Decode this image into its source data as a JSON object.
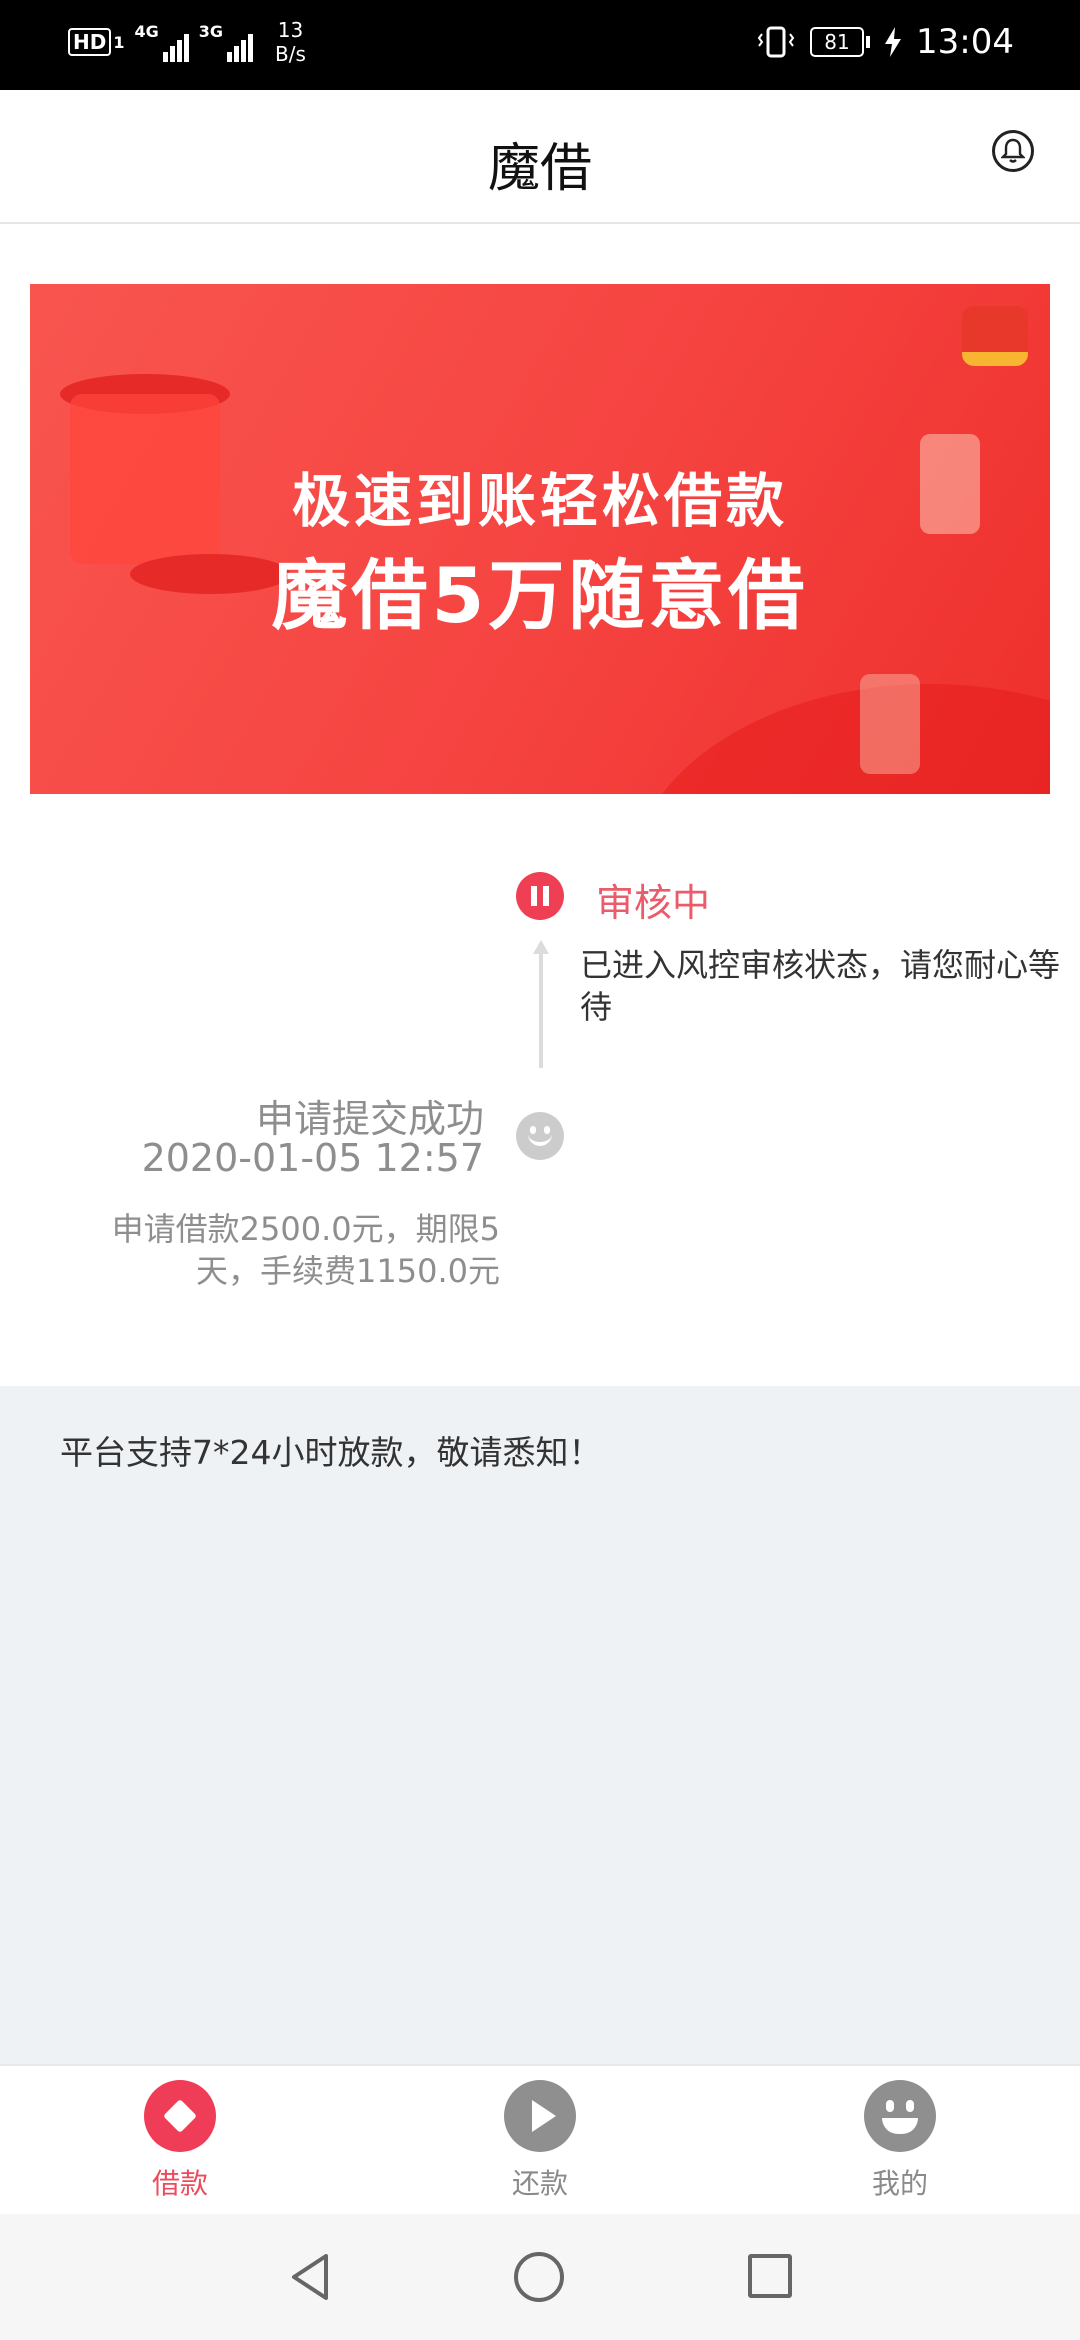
{
  "status_bar": {
    "hd_badge": "HD",
    "sim1_badge": "1",
    "network1": "4G",
    "network2": "3G",
    "speed_value": "13",
    "speed_unit": "B/s",
    "battery": "81",
    "time": "13:04"
  },
  "header": {
    "title": "魔借",
    "icon": "bell-icon"
  },
  "banner": {
    "line1": "极速到账轻松借款",
    "line2": "魔借5万随意借"
  },
  "timeline": {
    "current": {
      "title": "审核中",
      "description": "已进入风控审核状态，请您耐心等待",
      "icon": "pause-icon",
      "color": "#ef3f55"
    },
    "submitted": {
      "title": "申请提交成功",
      "time": "2020-01-05 12:57",
      "description": "申请借款2500.0元，期限5天，手续费1150.0元",
      "icon": "smile-icon"
    }
  },
  "notice": {
    "text": "平台支持7*24小时放款，敬请悉知！"
  },
  "tabbar": {
    "items": [
      {
        "label": "借款",
        "icon": "borrow-icon",
        "active": true
      },
      {
        "label": "还款",
        "icon": "play-icon",
        "active": false
      },
      {
        "label": "我的",
        "icon": "smiley-icon",
        "active": false
      }
    ],
    "active_color": "#ee4a5e"
  }
}
